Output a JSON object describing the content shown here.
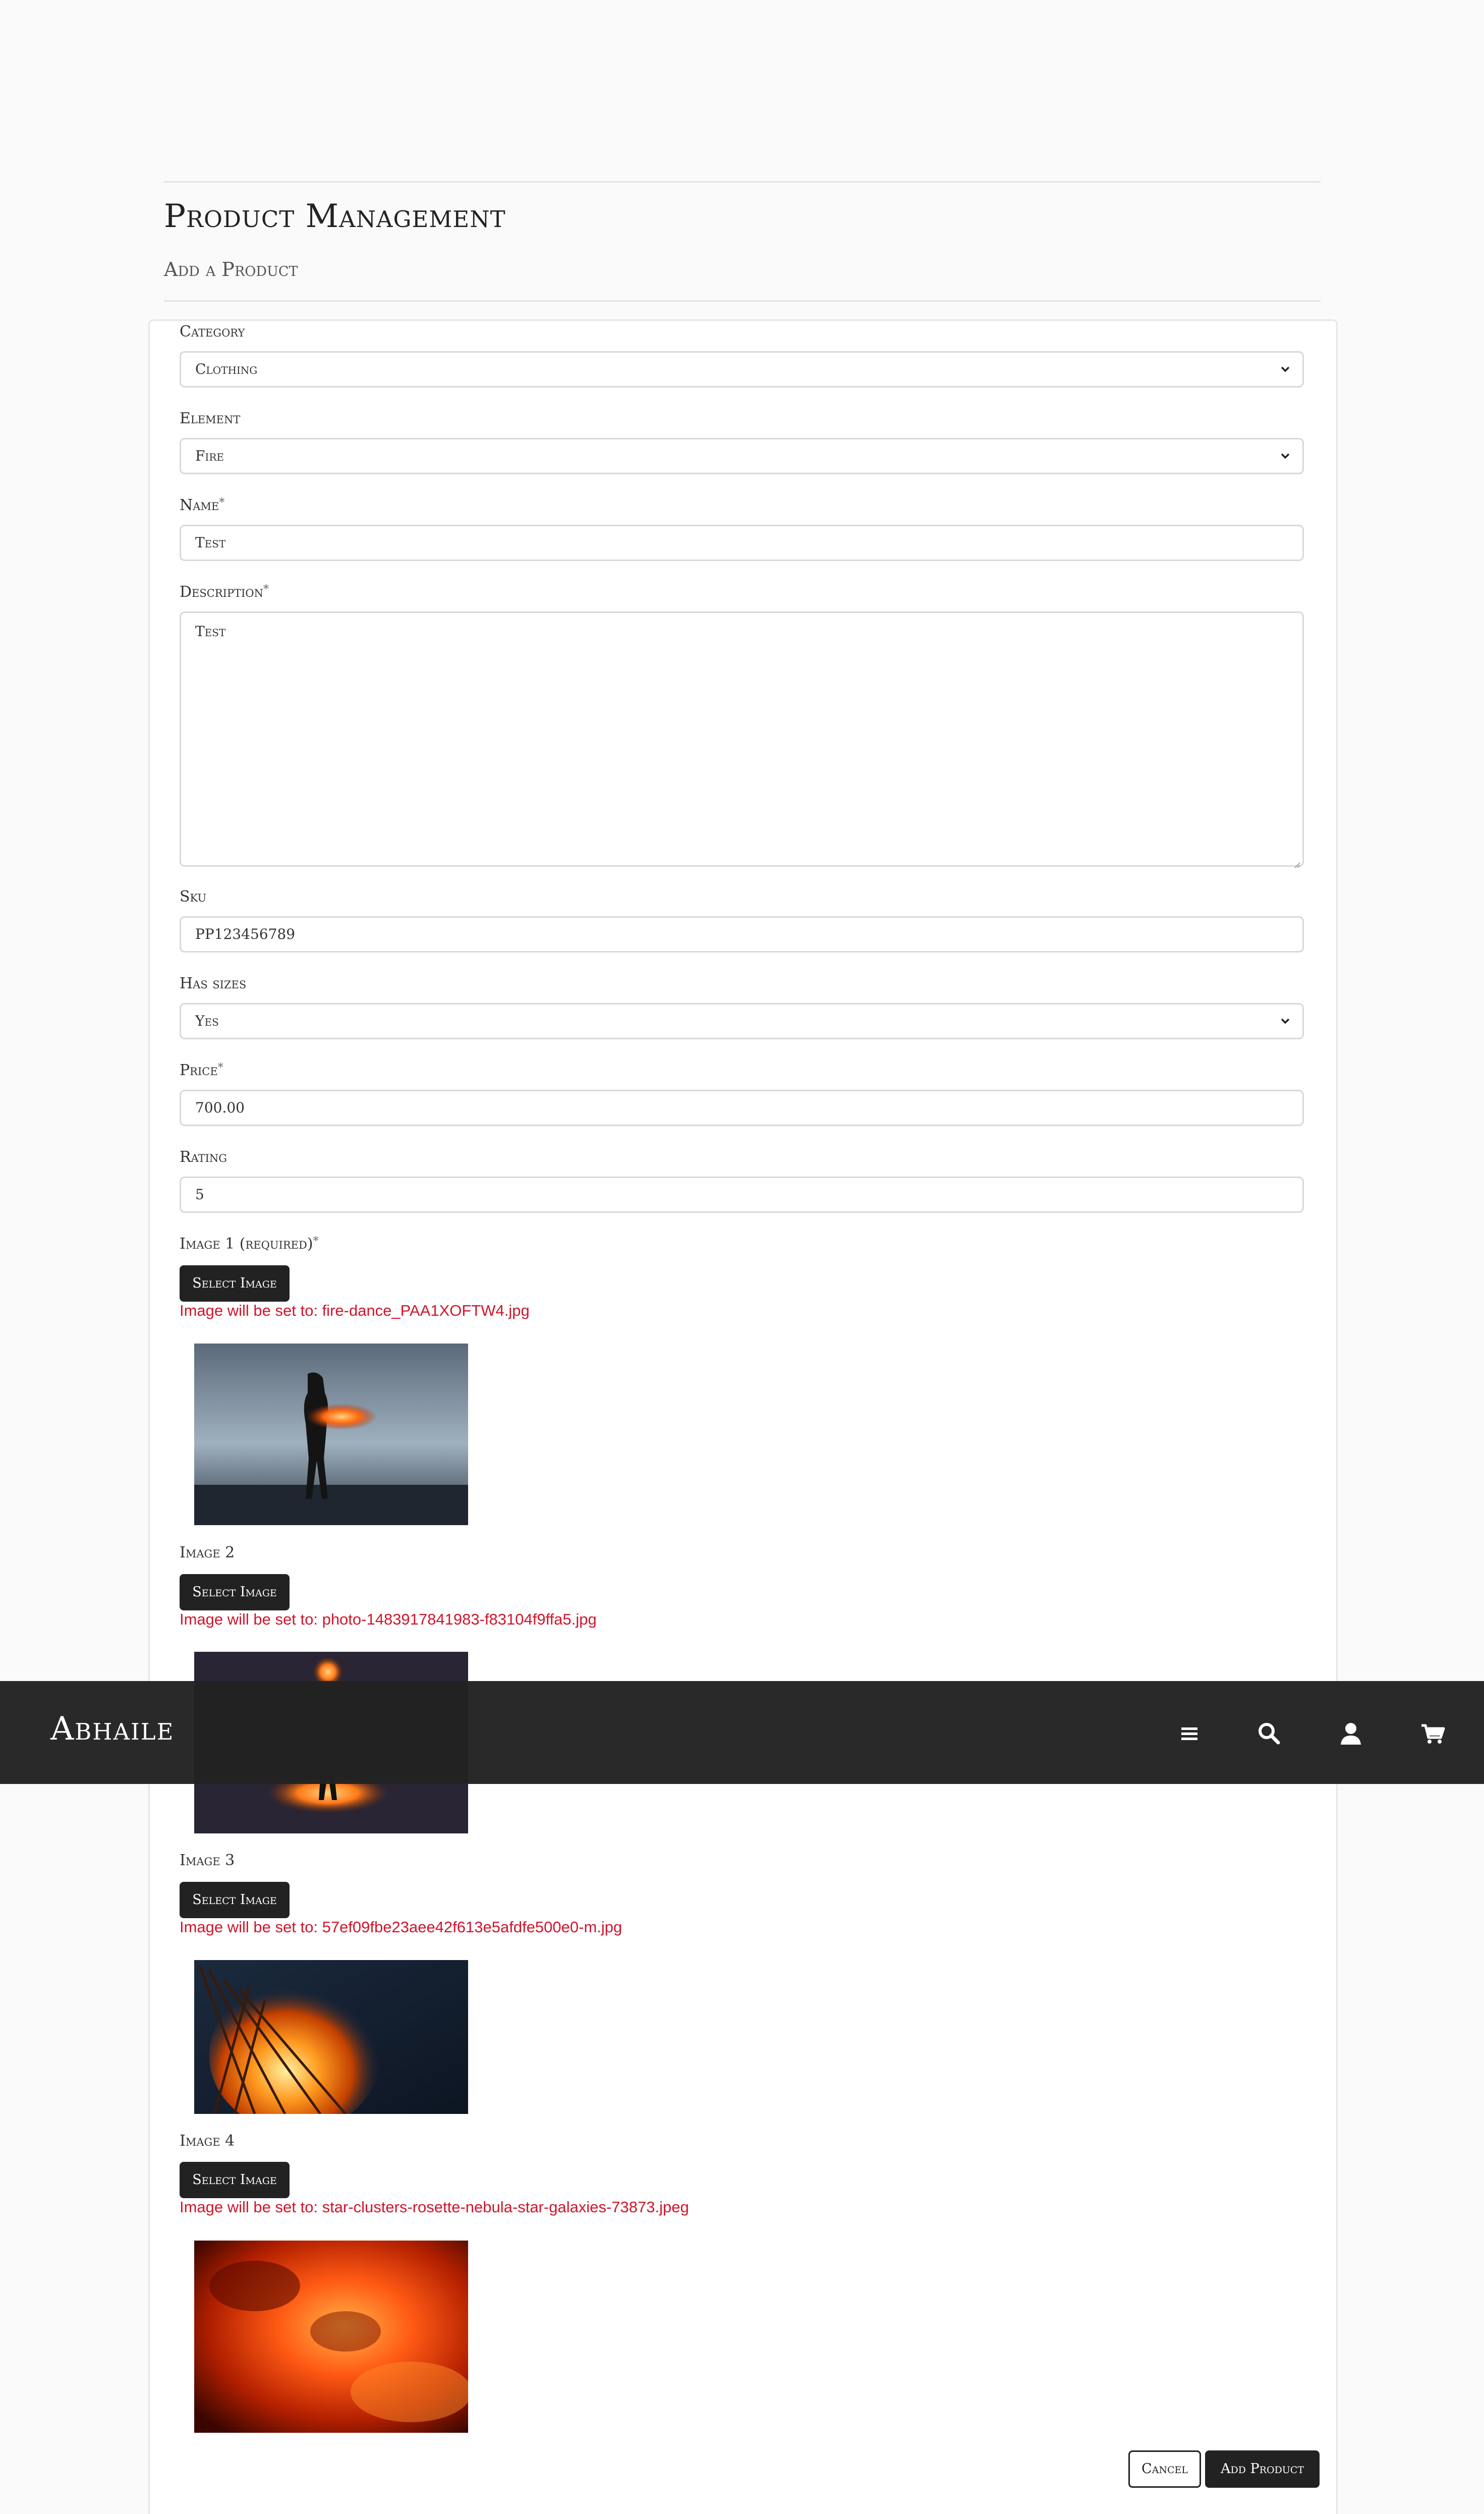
{
  "header": {
    "title": "Product Management",
    "subtitle": "Add a Product"
  },
  "form": {
    "category": {
      "label": "Category",
      "value": "Clothing"
    },
    "element": {
      "label": "Element",
      "value": "Fire"
    },
    "name": {
      "label": "Name",
      "value": "Test",
      "required_mark": "*"
    },
    "description": {
      "label": "Description",
      "value": "Test",
      "required_mark": "*"
    },
    "sku": {
      "label": "Sku",
      "value": "PP123456789"
    },
    "has_sizes": {
      "label": "Has sizes",
      "value": "Yes"
    },
    "price": {
      "label": "Price",
      "value": "700.00",
      "required_mark": "*"
    },
    "rating": {
      "label": "Rating",
      "value": "5"
    },
    "images": [
      {
        "label": "Image 1 (required)",
        "required_mark": "*",
        "button": "Select Image",
        "note": "Image will be set to: fire-dance_PAA1XOFTW4.jpg"
      },
      {
        "label": "Image 2",
        "button": "Select Image",
        "note": "Image will be set to: photo-1483917841983-f83104f9ffa5.jpg"
      },
      {
        "label": "Image 3",
        "button": "Select Image",
        "note": "Image will be set to: 57ef09fbe23aee42f613e5afdfe500e0-m.jpg"
      },
      {
        "label": "Image 4",
        "button": "Select Image",
        "note": "Image will be set to: star-clusters-rosette-nebula-star-galaxies-73873.jpeg"
      }
    ],
    "cancel_label": "Cancel",
    "submit_label": "Add Product"
  },
  "navbar": {
    "brand": "Abhaile",
    "icons": [
      "menu-icon",
      "search-icon",
      "user-icon",
      "cart-icon"
    ]
  },
  "colors": {
    "accent_dark": "#222222",
    "error_text": "#d0152b",
    "background": "#fafafa"
  }
}
